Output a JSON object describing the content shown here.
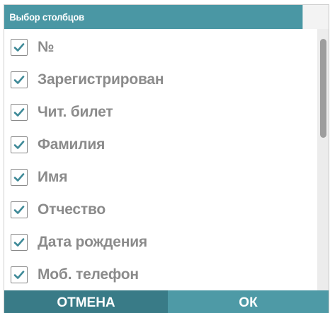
{
  "dialog": {
    "title": "Выбор столбцов"
  },
  "columns": [
    {
      "label": "№",
      "checked": true
    },
    {
      "label": "Зарегистрирован",
      "checked": true
    },
    {
      "label": "Чит. билет",
      "checked": true
    },
    {
      "label": "Фамилия",
      "checked": true
    },
    {
      "label": "Имя",
      "checked": true
    },
    {
      "label": "Отчество",
      "checked": true
    },
    {
      "label": "Дата рождения",
      "checked": true
    },
    {
      "label": "Моб. телефон",
      "checked": true
    }
  ],
  "footer": {
    "cancel_label": "ОТМЕНА",
    "ok_label": "ОК"
  },
  "colors": {
    "accent": "#4a97a4",
    "cancel_bg": "#397b87",
    "ok_bg": "#4e9aa6",
    "check_color": "#3f8a98",
    "label_color": "#8b8b8b"
  },
  "icons": {
    "checkbox_mark": "checkmark-icon"
  }
}
